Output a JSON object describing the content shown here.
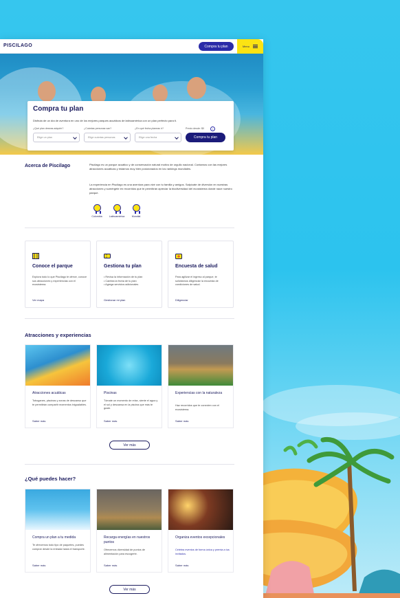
{
  "navbar": {
    "logo": "PISCILAGO",
    "cta_label": "Compra tu plan",
    "menu_label": "Menu"
  },
  "hero": {
    "plan_title": "Compra tu plan",
    "plan_description": "Disfruta de un día de aventura en uno de los mejores parques acuáticos de latinoamérica con un plan perfecto para ti.",
    "fields": [
      {
        "label": "¿Qué plan deseas adquirir?",
        "placeholder": "Elige un plan"
      },
      {
        "label": "¿Cuántas personas van?",
        "placeholder": "Elige cuántas personas"
      },
      {
        "label": "¿En qué fecha planeas ir?",
        "placeholder": "Elige una fecha"
      }
    ],
    "price_label": "Precio desde: $0",
    "info_glyph": "i",
    "buy_label": "Compra tu plan"
  },
  "about": {
    "title": "Acerca de Piscilago",
    "paragraph_1": "Piscilago es un parque acuático y de conservación natural motivo de orgullo nacional. Contamos con las mejores atracciones acuáticas y estamos muy bien posicionados en los rankings mundiales.",
    "paragraph_2": "La experiencia en Piscilago es una aventura para vivir con tu familia y amigos. Salpícate de diversión en nuestras atracciones y sumérgete en recorridos que te permitirán apreciar la biodiversidad del ecosistema donde nace nuestro parque.",
    "badges": [
      "Colombia",
      "Latinoamérica",
      "Mundial"
    ]
  },
  "info_cards": [
    {
      "title": "Conoce el parque",
      "description": "Explora todo lo que Piscilago te ofrece, conoce sus atracciones y experiencias con el ecosistema.",
      "link": "Ver mapa",
      "icon": "map-icon"
    },
    {
      "title": "Gestiona tu plan",
      "description": "• Revisa la información de tu plan\n• Cambia la fecha de tu plan\n• Agrega servicios adicionales",
      "link": "Gestionar mi plan",
      "icon": "ticket-icon"
    },
    {
      "title": "Encuesta de salud",
      "description": "Para agilizar el ingreso al parque, te solicitamos diligenciar la encuesta de condiciones de salud.",
      "link": "Diligenciar",
      "icon": "health-icon"
    }
  ],
  "attractions": {
    "title": "Atracciones y experiencias",
    "cards": [
      {
        "title": "Atracciones acuáticas",
        "description": "Toboganes, piscinas y zonas de descanso que te permitirán compartir momentos inigualables.",
        "link": "Saber más"
      },
      {
        "title": "Piscinas",
        "description": "Tómate un momento de relax, siente el agua y el sol y descansa en la piscina que más te guste.",
        "link": "Saber más"
      },
      {
        "title": "Experiencias con la naturaleza",
        "description": "Haz recorridos que te conecten con el ecosistema.",
        "link": "Saber más"
      }
    ],
    "more_label": "Ver más"
  },
  "things_to_do": {
    "title": "¿Qué puedes hacer?",
    "cards": [
      {
        "title": "Compra un plan a tu medida",
        "description": "Te ofrecemos todo tipo de paquetes, puedes comprar desde la entrada hasta el transporte.",
        "link": "Saber más"
      },
      {
        "title": "Recarga energías en nuestros puntos",
        "description": "Ofrecemos diversidad de puntos de alimentación para escogerte.",
        "link": "Saber más"
      },
      {
        "title": "Organiza eventos excepcionales",
        "description": "Celebra eventos de forma única y premia a tus invitados.",
        "link": "Saber más"
      }
    ],
    "more_label": "Ver más"
  },
  "colors": {
    "navy": "#1b1b5e",
    "accent_blue": "#2b2ba8",
    "yellow": "#fbe313",
    "sky": "#2cc3ee"
  }
}
